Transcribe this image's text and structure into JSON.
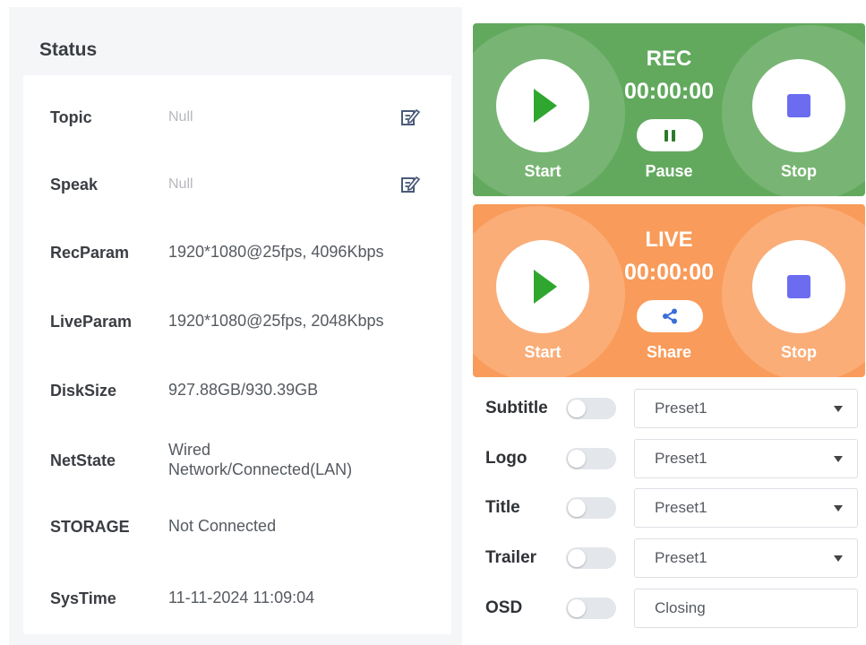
{
  "status": {
    "title": "Status",
    "rows": [
      {
        "label": "Topic",
        "value": "Null"
      },
      {
        "label": "Speak",
        "value": "Null"
      },
      {
        "label": "RecParam",
        "value": "1920*1080@25fps, 4096Kbps"
      },
      {
        "label": "LiveParam",
        "value": "1920*1080@25fps, 2048Kbps"
      },
      {
        "label": "DiskSize",
        "value": "927.88GB/930.39GB"
      },
      {
        "label": "NetState",
        "value": "Wired Network/Connected(LAN)"
      },
      {
        "label": "STORAGE",
        "value": "Not Connected"
      },
      {
        "label": "SysTime",
        "value": "11-11-2024 11:09:04"
      }
    ],
    "edit_icon": "edit-icon"
  },
  "rec": {
    "title": "REC",
    "time": "00:00:00",
    "start_label": "Start",
    "pause_label": "Pause",
    "stop_label": "Stop",
    "color": "#62a95e"
  },
  "live": {
    "title": "LIVE",
    "time": "00:00:00",
    "start_label": "Start",
    "share_label": "Share",
    "stop_label": "Stop",
    "color": "#f99b5a"
  },
  "options": [
    {
      "label": "Subtitle",
      "enabled": false,
      "value": "Preset1"
    },
    {
      "label": "Logo",
      "enabled": false,
      "value": "Preset1"
    },
    {
      "label": "Title",
      "enabled": false,
      "value": "Preset1"
    },
    {
      "label": "Trailer",
      "enabled": false,
      "value": "Preset1"
    },
    {
      "label": "OSD",
      "enabled": false,
      "value": "Closing"
    }
  ],
  "colors": {
    "play": "#2fa72f",
    "stop": "#6b6cf0",
    "toggle_off": "#e3e6eb"
  }
}
